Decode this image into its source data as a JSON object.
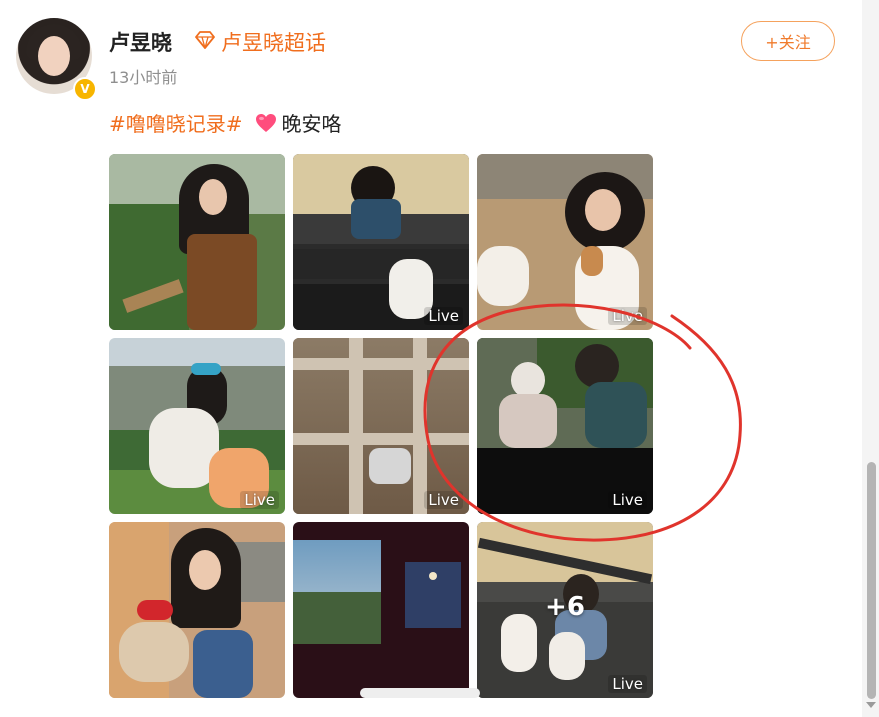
{
  "user": {
    "name": "卢昱晓",
    "verified_badge": "V",
    "topic_link": "卢昱晓超话",
    "topic_icon": "gem-icon",
    "time": "13小时前"
  },
  "follow_button": "+关注",
  "post": {
    "hashtag": "#噜噜晓记录#",
    "emoji": "heart-icon",
    "text": "晚安咯"
  },
  "images": [
    {
      "live": ""
    },
    {
      "live": "Live"
    },
    {
      "live": "Live"
    },
    {
      "live": "Live"
    },
    {
      "live": "Live"
    },
    {
      "live": "Live"
    },
    {
      "live": ""
    },
    {
      "live": ""
    },
    {
      "live": "Live",
      "more": "+6"
    }
  ],
  "colors": {
    "accent": "#f06e1e",
    "follow_border": "#f5a25d",
    "annotation": "#e0342c",
    "verified": "#f7b500"
  }
}
